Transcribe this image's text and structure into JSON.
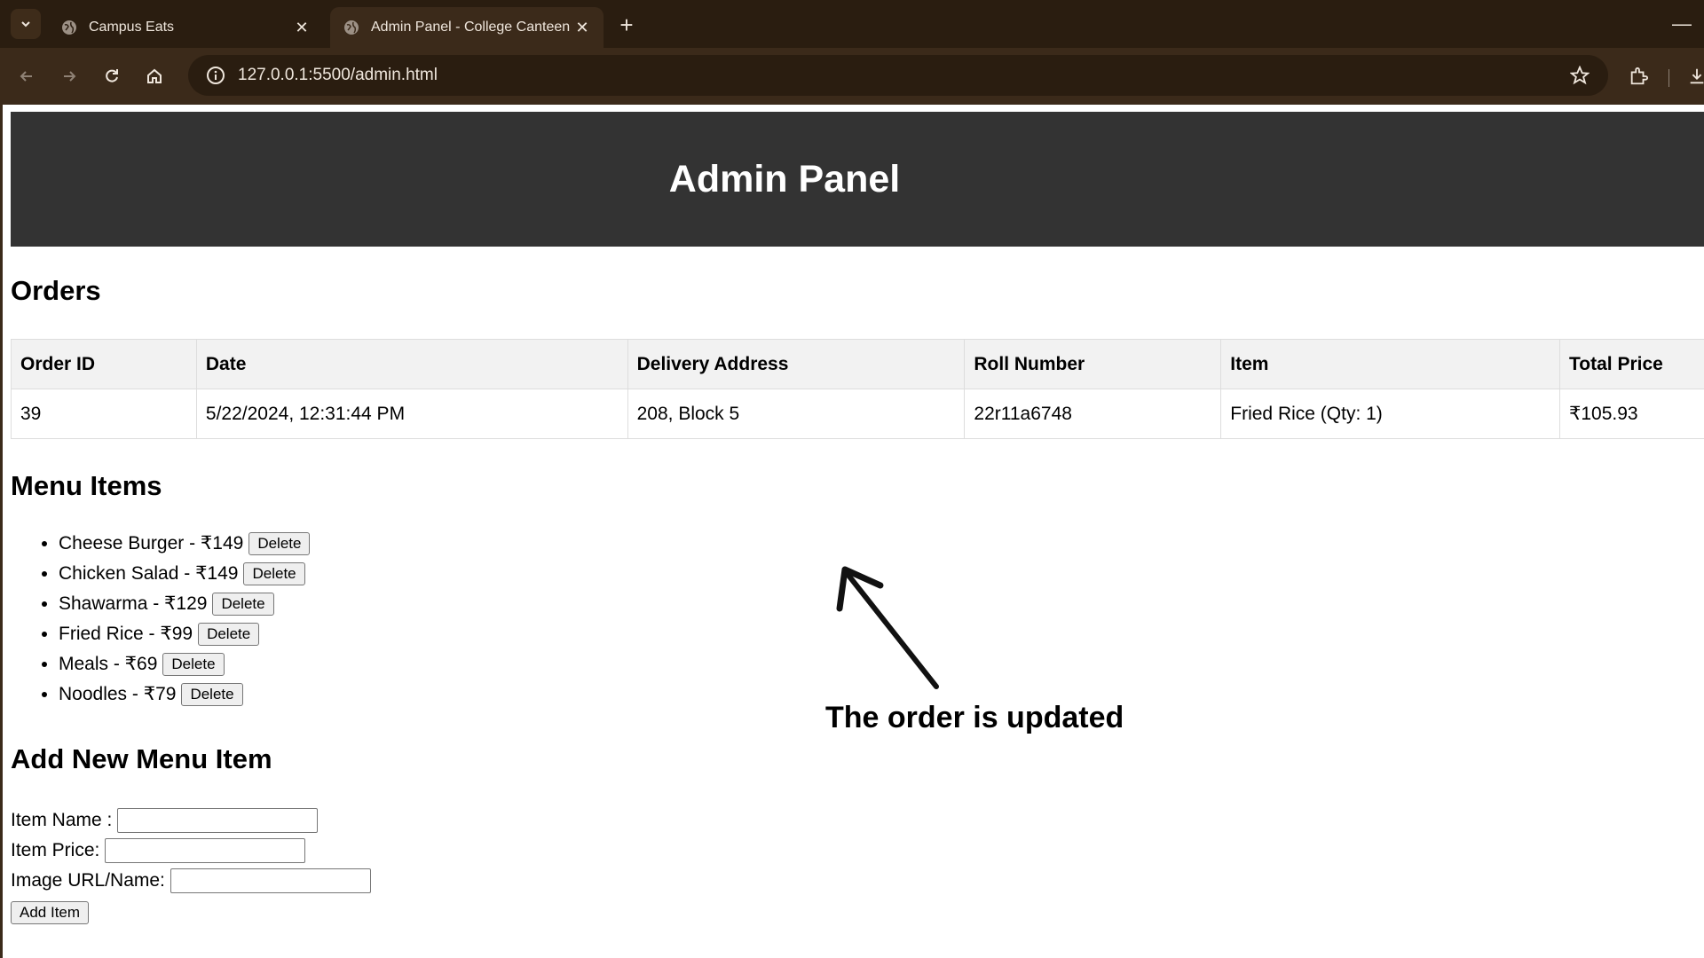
{
  "browser": {
    "tabs": [
      {
        "title": "Campus Eats"
      },
      {
        "title": "Admin Panel - College Canteen"
      }
    ],
    "url": "127.0.0.1:5500/admin.html"
  },
  "header": {
    "title": "Admin Panel"
  },
  "orders": {
    "heading": "Orders",
    "columns": [
      "Order ID",
      "Date",
      "Delivery Address",
      "Roll Number",
      "Item",
      "Total Price"
    ],
    "rows": [
      [
        "39",
        "5/22/2024, 12:31:44 PM",
        "208, Block 5",
        "22r11a6748",
        "Fried Rice (Qty: 1)",
        "₹105.93"
      ]
    ]
  },
  "menu": {
    "heading": "Menu Items",
    "items": [
      {
        "label": "Cheese Burger - ₹149",
        "button": "Delete"
      },
      {
        "label": "Chicken Salad - ₹149",
        "button": "Delete"
      },
      {
        "label": "Shawarma - ₹129",
        "button": "Delete"
      },
      {
        "label": "Fried Rice - ₹99",
        "button": "Delete"
      },
      {
        "label": "Meals - ₹69",
        "button": "Delete"
      },
      {
        "label": "Noodles - ₹79",
        "button": "Delete"
      }
    ]
  },
  "add_form": {
    "heading": "Add New Menu Item",
    "name_label": "Item Name :",
    "price_label": "Item Price:",
    "image_label": "Image URL/Name:",
    "submit_label": "Add Item"
  },
  "annotation": {
    "text": "The order is updated"
  }
}
